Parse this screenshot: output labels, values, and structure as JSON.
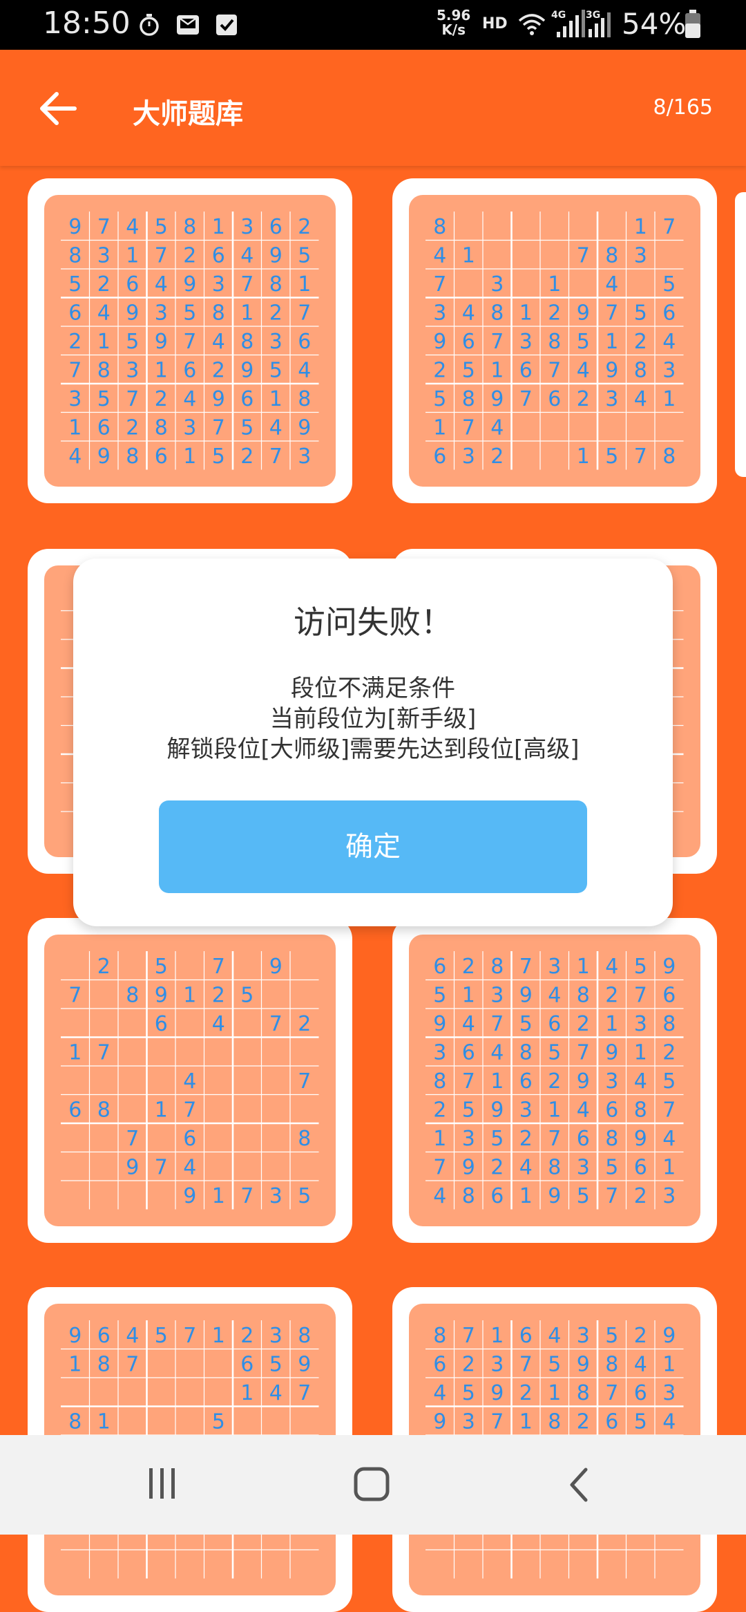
{
  "status_bar": {
    "time": "18:50",
    "net_speed": "5.96",
    "net_unit": "K/s",
    "hd": "HD",
    "battery": "54%",
    "icons": [
      "timer-icon",
      "mail-icon",
      "check-box-icon",
      "wifi-icon",
      "signal-4g-icon",
      "signal-3g-icon",
      "battery-icon"
    ]
  },
  "toolbar": {
    "title": "大师题库",
    "counter": "8/165",
    "back_icon": "arrow-left-icon"
  },
  "colors": {
    "background": "#ff6520",
    "grid_bg": "#ffa47a",
    "digit": "#2f8ee6",
    "dialog_button": "#56b9f6"
  },
  "puzzles": [
    [
      "974581362",
      "831726495",
      "526493781",
      "649358127",
      "215974836",
      "783162954",
      "357249618",
      "162837549",
      "498615273"
    ],
    [
      "8......17",
      "41...783.",
      "7.3.1.4.5",
      "348129756",
      "967385124",
      "251674983",
      "589762341",
      "174......",
      "632..1578"
    ],
    [
      "",
      "",
      "",
      "",
      "",
      "",
      "",
      "",
      ""
    ],
    [
      "",
      "",
      "",
      "",
      "",
      "",
      "",
      "",
      ""
    ],
    [
      ".2.5.7.9.",
      "7.89125..",
      "...6.4.72",
      "17.......",
      "....4...7",
      "68.17....",
      "..7.6...8",
      "..974....",
      "....91735"
    ],
    [
      "628731459",
      "513948276",
      "947562138",
      "364857912",
      "871629345",
      "259314687",
      "135276894",
      "792483561",
      "486195723"
    ],
    [
      "964571238",
      "187...659",
      "......147",
      "81...5...",
      "",
      "",
      "",
      "",
      ""
    ],
    [
      "871643529",
      "623759841",
      "459218763",
      "937182654",
      "",
      "",
      "",
      "",
      ""
    ]
  ],
  "dialog": {
    "title": "访问失败！",
    "line1": "段位不满足条件",
    "line2": "当前段位为[新手级]",
    "line3": "解锁段位[大师级]需要先达到段位[高级]",
    "button": "确定"
  },
  "nav": {
    "recent": "recent-apps-icon",
    "home": "home-icon",
    "back": "back-chevron-icon"
  }
}
